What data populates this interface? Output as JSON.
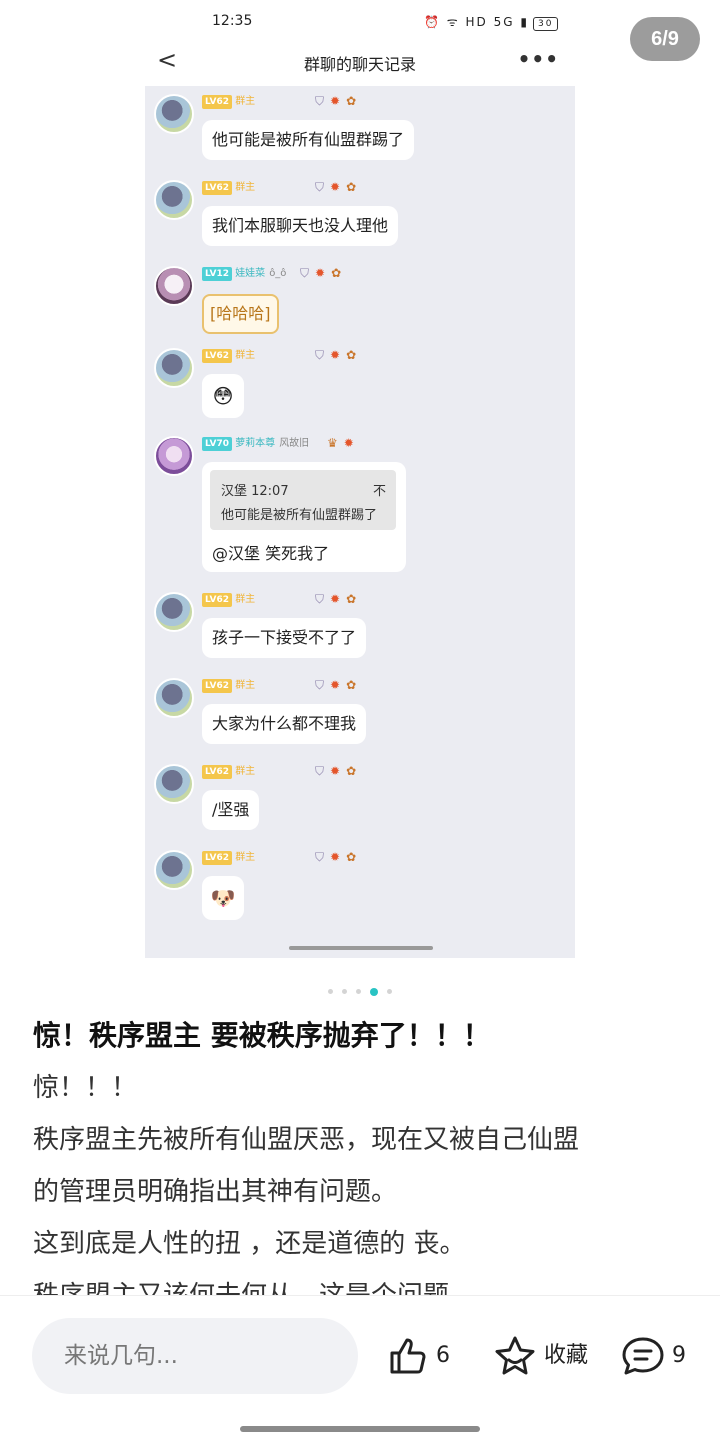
{
  "status_bar": {
    "time": "12:35",
    "icons": "⏰ ᯤ HD 5G ▮",
    "battery": "30"
  },
  "image_counter": "6/9",
  "screenshot": {
    "nav": {
      "back": "<",
      "title": "群聊的聊天记录",
      "more": "•••"
    },
    "messages": [
      {
        "level": "LV62",
        "role": "群主",
        "nick": "",
        "text": "他可能是被所有仙盟群踢了"
      },
      {
        "level": "LV62",
        "role": "群主",
        "nick": "",
        "text": "我们本服聊天也没人理他"
      },
      {
        "level": "LV12",
        "role": "娃娃菜",
        "nick": "ô_ô",
        "text": "[哈哈哈]"
      },
      {
        "level": "LV62",
        "role": "群主",
        "nick": "",
        "text": "😳"
      },
      {
        "level": "LV70",
        "role": "萝莉本尊",
        "nick": "风故旧",
        "quote_name": "汉堡 12:07",
        "quote_close": "不",
        "quote_text": "他可能是被所有仙盟群踢了",
        "text": "@汉堡 笑死我了"
      },
      {
        "level": "LV62",
        "role": "群主",
        "nick": "",
        "text": "孩子一下接受不了了"
      },
      {
        "level": "LV62",
        "role": "群主",
        "nick": "",
        "text": "大家为什么都不理我"
      },
      {
        "level": "LV62",
        "role": "群主",
        "nick": "",
        "text": "/坚强"
      },
      {
        "level": "LV62",
        "role": "群主",
        "nick": "",
        "text": "🐶"
      }
    ]
  },
  "pager": {
    "count": 5,
    "active": 3
  },
  "post": {
    "title": "惊！秩序盟主 要被秩序抛弃了！！！",
    "lines": [
      "惊！！！",
      "秩序盟主先被所有仙盟厌恶，现在又被自己仙盟",
      "的管理员明确指出其神有问题。",
      "这到底是人性的扭 ，还是道德的 丧。",
      "秩序盟主又该何去何从，这是个问题"
    ]
  },
  "bottom": {
    "input_placeholder": "来说几句...",
    "like_count": "6",
    "favorite_label": "收藏",
    "comment_count": "9"
  },
  "colors": {
    "accent": "#29c3c3",
    "level_gold": "#f4c64c",
    "level_teal": "#4dd0d6",
    "chat_bg": "#ebecf2"
  }
}
